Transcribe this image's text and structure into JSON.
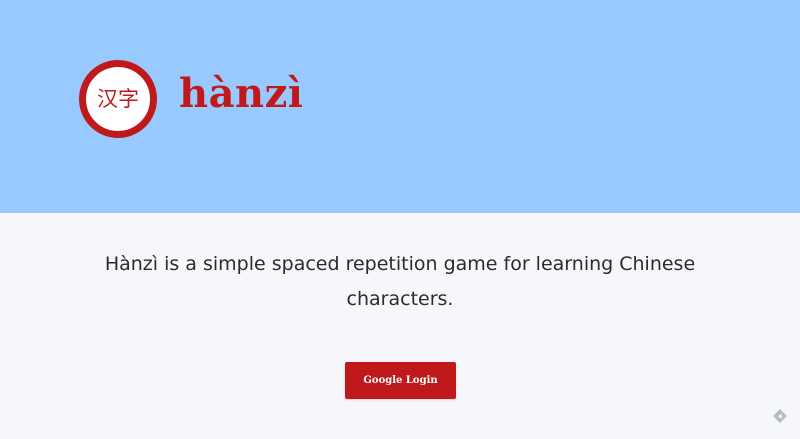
{
  "header": {
    "logo_text": "汉字",
    "brand_name": "hànzì"
  },
  "main": {
    "tagline": "Hànzì is a simple spaced repetition game for learning Chinese characters.",
    "login_button_label": "Google Login"
  },
  "colors": {
    "hero_background": "#99caff",
    "page_background": "#f6f7fb",
    "brand_red": "#c0191c",
    "text_dark": "#2b2b2b"
  },
  "icons": {
    "corner": "feedback-icon"
  }
}
